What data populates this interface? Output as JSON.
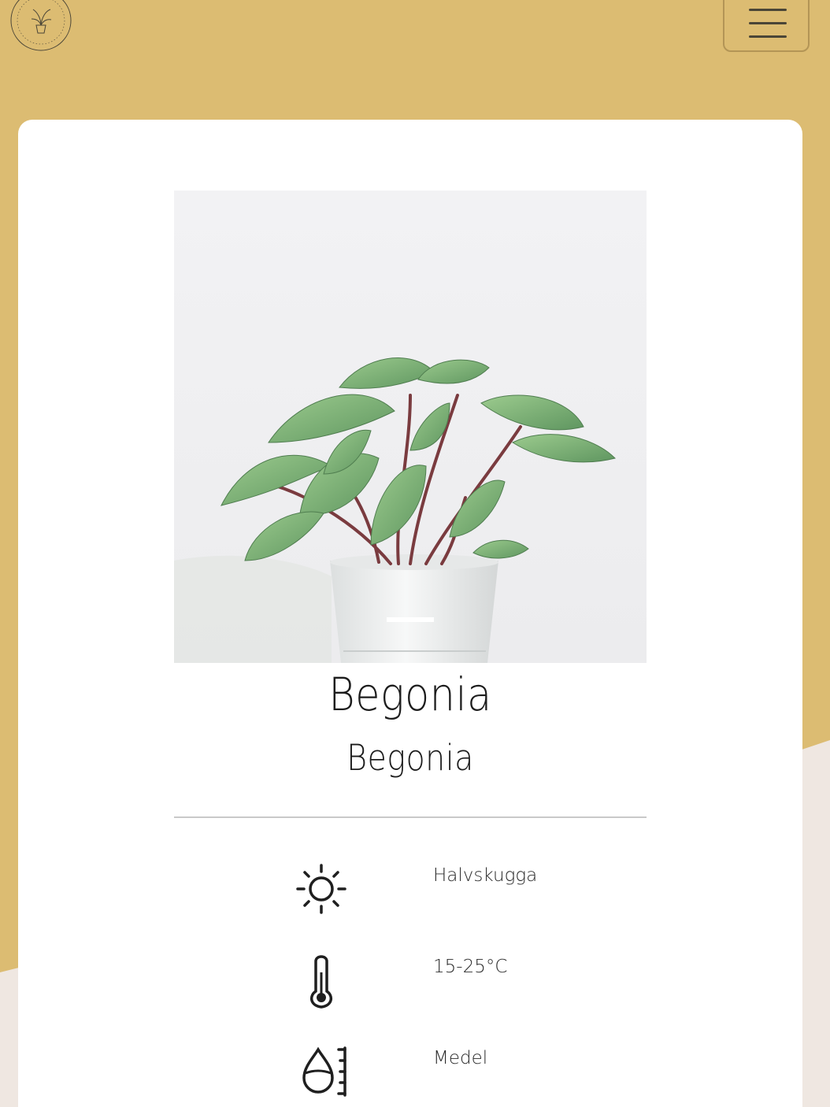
{
  "header": {
    "logo_icon": "plant-pot-logo",
    "menu_icon": "hamburger-menu-icon"
  },
  "colors": {
    "background": "#dcbc72",
    "card": "#ffffff",
    "accent_shape": "#efe7e1",
    "text": "#1c1c1c"
  },
  "product": {
    "image_alt": "Begonia plant in white pot",
    "carousel": {
      "active_index": 1,
      "total": 1
    },
    "name": "Begonia",
    "latin_name": "Begonia"
  },
  "care": [
    {
      "icon": "sun-icon",
      "value": "Halvskugga"
    },
    {
      "icon": "thermometer-icon",
      "value": "15-25°C"
    },
    {
      "icon": "water-drop-icon",
      "value": "Medel"
    }
  ]
}
